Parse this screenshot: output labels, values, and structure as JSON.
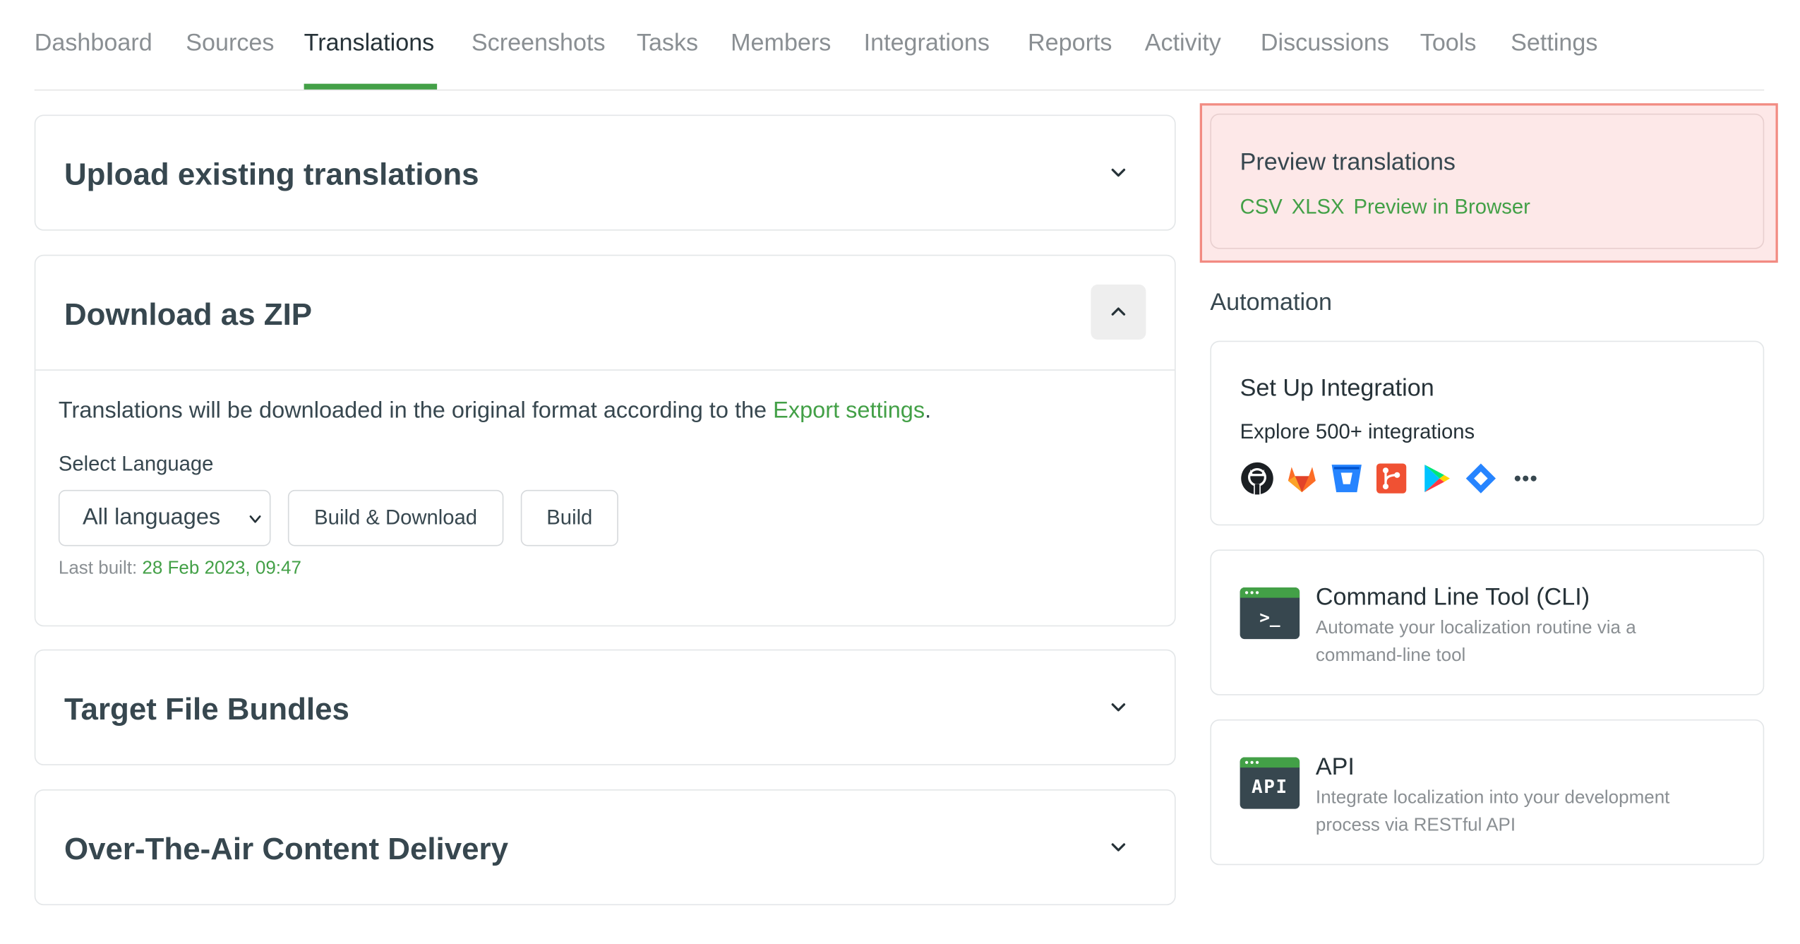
{
  "tabs": [
    {
      "label": "Dashboard"
    },
    {
      "label": "Sources"
    },
    {
      "label": "Translations"
    },
    {
      "label": "Screenshots"
    },
    {
      "label": "Tasks"
    },
    {
      "label": "Members"
    },
    {
      "label": "Integrations"
    },
    {
      "label": "Reports"
    },
    {
      "label": "Activity"
    },
    {
      "label": "Discussions"
    },
    {
      "label": "Tools"
    },
    {
      "label": "Settings"
    }
  ],
  "active_tab": "Translations",
  "upload": {
    "title": "Upload existing translations"
  },
  "zip": {
    "title": "Download as ZIP",
    "desc_prefix": "Translations will be downloaded in the original format according to the ",
    "desc_link": "Export settings",
    "desc_suffix": ".",
    "select_label": "Select Language",
    "select_value": "All languages",
    "build_download_label": "Build & Download",
    "build_label": "Build",
    "last_built_label": "Last built: ",
    "last_built_value": "28 Feb 2023, 09:47"
  },
  "bundles": {
    "title": "Target File Bundles"
  },
  "ota": {
    "title": "Over-The-Air Content Delivery"
  },
  "preview": {
    "title": "Preview translations",
    "links": [
      "CSV",
      "XLSX",
      "Preview in Browser"
    ]
  },
  "automation": {
    "label": "Automation"
  },
  "integration": {
    "title": "Set Up Integration",
    "link": "Explore 500+ integrations",
    "icons": [
      "github-icon",
      "gitlab-icon",
      "bitbucket-icon",
      "git-icon",
      "google-play-icon",
      "jira-icon",
      "more-icon"
    ]
  },
  "cli": {
    "title": "Command Line Tool (CLI)",
    "desc": "Automate your localization routine via a command-line tool",
    "icon_text": ">_"
  },
  "api": {
    "title": "API",
    "desc": "Integrate localization into your development process via RESTful API",
    "icon_text": "API"
  },
  "colors": {
    "accent": "#43a047",
    "highlight_border": "#f28b82",
    "highlight_fill": "#fde8e8"
  }
}
